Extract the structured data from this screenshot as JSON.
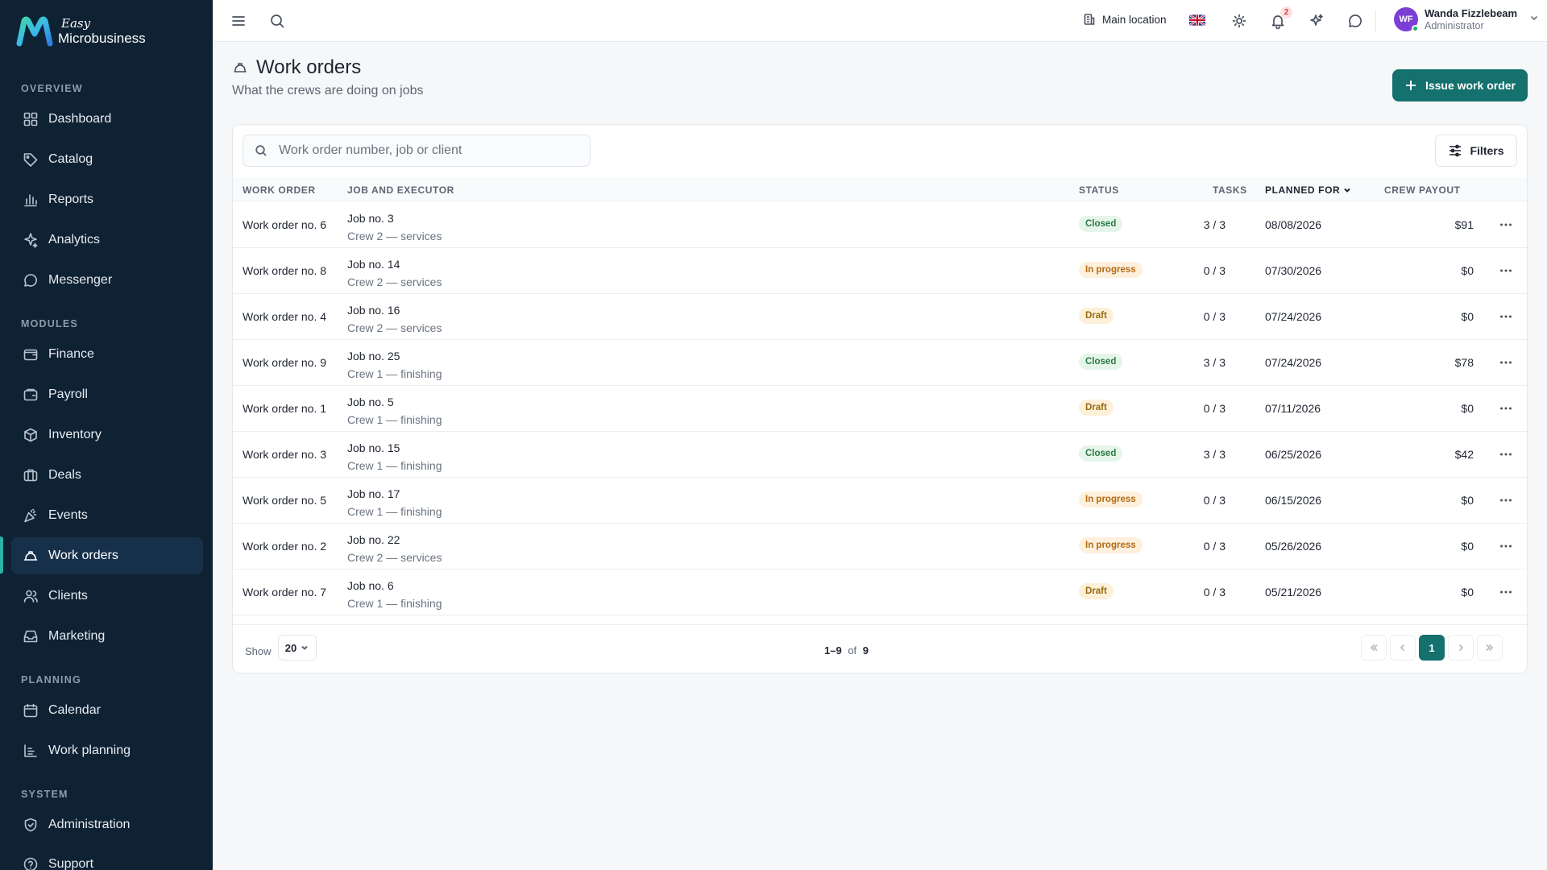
{
  "brand": {
    "easy": "Easy",
    "name": "Microbusiness"
  },
  "sidebar": {
    "sections": [
      {
        "label": "OVERVIEW"
      },
      {
        "label": "MODULES"
      },
      {
        "label": "PLANNING"
      },
      {
        "label": "SYSTEM"
      }
    ],
    "items": [
      {
        "label": "Dashboard",
        "icon": "grid-icon"
      },
      {
        "label": "Catalog",
        "icon": "tag-icon"
      },
      {
        "label": "Reports",
        "icon": "bar-chart-icon"
      },
      {
        "label": "Analytics",
        "icon": "sparkle-icon"
      },
      {
        "label": "Messenger",
        "icon": "chat-icon"
      },
      {
        "label": "Finance",
        "icon": "wallet-icon"
      },
      {
        "label": "Payroll",
        "icon": "payroll-icon"
      },
      {
        "label": "Inventory",
        "icon": "box-icon"
      },
      {
        "label": "Deals",
        "icon": "briefcase-icon"
      },
      {
        "label": "Events",
        "icon": "party-icon"
      },
      {
        "label": "Work orders",
        "icon": "hard-hat-icon",
        "active": true
      },
      {
        "label": "Clients",
        "icon": "users-icon"
      },
      {
        "label": "Marketing",
        "icon": "inbox-icon"
      },
      {
        "label": "Calendar",
        "icon": "calendar-icon"
      },
      {
        "label": "Work planning",
        "icon": "list-icon"
      },
      {
        "label": "Administration",
        "icon": "shield-icon"
      },
      {
        "label": "Support",
        "icon": "help-icon"
      }
    ]
  },
  "topbar": {
    "location": "Main location",
    "notifications_count": "2",
    "user": {
      "initials": "WF",
      "name": "Wanda Fizzlebeam",
      "role": "Administrator"
    }
  },
  "page": {
    "title": "Work orders",
    "subtitle": "What the crews are doing on jobs",
    "issue_button": "Issue work order"
  },
  "search": {
    "placeholder": "Work order number, job or client"
  },
  "filters_label": "Filters",
  "table": {
    "headers": {
      "work_order": "WORK ORDER",
      "job": "JOB AND EXECUTOR",
      "status": "STATUS",
      "tasks": "TASKS",
      "planned": "PLANNED FOR",
      "payout": "CREW PAYOUT"
    },
    "rows": [
      {
        "wo": "Work order no. 6",
        "job": "Job no. 3",
        "crew": "Crew 2 — services",
        "status": "Closed",
        "tasks": "3 / 3",
        "date": "08/08/2026",
        "payout": "$91"
      },
      {
        "wo": "Work order no. 8",
        "job": "Job no. 14",
        "crew": "Crew 2 — services",
        "status": "In progress",
        "tasks": "0 / 3",
        "date": "07/30/2026",
        "payout": "$0"
      },
      {
        "wo": "Work order no. 4",
        "job": "Job no. 16",
        "crew": "Crew 2 — services",
        "status": "Draft",
        "tasks": "0 / 3",
        "date": "07/24/2026",
        "payout": "$0"
      },
      {
        "wo": "Work order no. 9",
        "job": "Job no. 25",
        "crew": "Crew 1 — finishing",
        "status": "Closed",
        "tasks": "3 / 3",
        "date": "07/24/2026",
        "payout": "$78"
      },
      {
        "wo": "Work order no. 1",
        "job": "Job no. 5",
        "crew": "Crew 1 — finishing",
        "status": "Draft",
        "tasks": "0 / 3",
        "date": "07/11/2026",
        "payout": "$0"
      },
      {
        "wo": "Work order no. 3",
        "job": "Job no. 15",
        "crew": "Crew 1 — finishing",
        "status": "Closed",
        "tasks": "3 / 3",
        "date": "06/25/2026",
        "payout": "$42"
      },
      {
        "wo": "Work order no. 5",
        "job": "Job no. 17",
        "crew": "Crew 1 — finishing",
        "status": "In progress",
        "tasks": "0 / 3",
        "date": "06/15/2026",
        "payout": "$0"
      },
      {
        "wo": "Work order no. 2",
        "job": "Job no. 22",
        "crew": "Crew 2 — services",
        "status": "In progress",
        "tasks": "0 / 3",
        "date": "05/26/2026",
        "payout": "$0"
      },
      {
        "wo": "Work order no. 7",
        "job": "Job no. 6",
        "crew": "Crew 1 — finishing",
        "status": "Draft",
        "tasks": "0 / 3",
        "date": "05/21/2026",
        "payout": "$0"
      }
    ]
  },
  "footer": {
    "show_label": "Show",
    "page_size": "20",
    "range": "1–9",
    "of": "of",
    "total": "9",
    "current_page": "1"
  },
  "colors": {
    "accent": "#14716d",
    "sidebar": "#0f2234",
    "closed": "#2d7a44",
    "in_progress": "#b36a12",
    "draft": "#9a6a12"
  }
}
